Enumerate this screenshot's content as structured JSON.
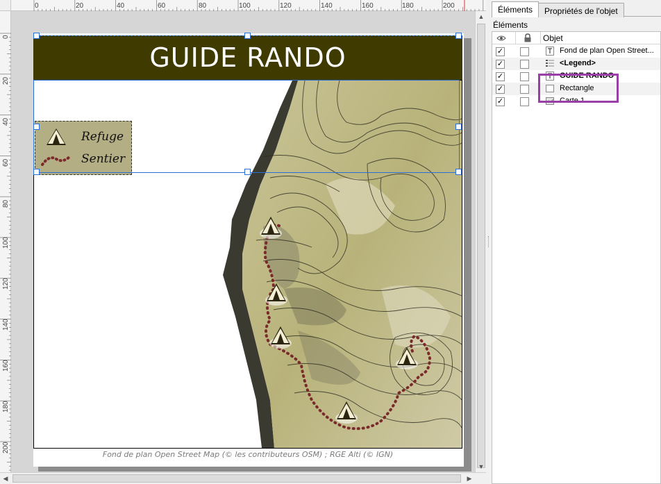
{
  "rulers": {
    "top_labels": [
      "0",
      "20",
      "40",
      "60",
      "80",
      "100",
      "120",
      "140",
      "160",
      "180",
      "200"
    ],
    "left_labels": [
      "0",
      "20",
      "40",
      "60",
      "80",
      "100",
      "120",
      "140",
      "160",
      "180",
      "200"
    ]
  },
  "layout_page": {
    "title": "GUIDE RANDO",
    "attribution": "Fond de plan Open Street Map (© les contributeurs OSM) ; RGE Alti (© IGN)",
    "title_background": "#3e3a00",
    "legend": {
      "background": "#b3ae84",
      "items": [
        {
          "label": "Refuge",
          "icon": "tent-icon"
        },
        {
          "label": "Sentier",
          "icon": "dotted-trail-icon"
        }
      ]
    },
    "trail_color": "#7a2a2a"
  },
  "panel": {
    "tabs": [
      "Éléments",
      "Propriétés de l'objet"
    ],
    "active_tab": "Éléments",
    "heading": "Éléments",
    "columns": {
      "visible": "eye-icon",
      "locked": "lock-icon",
      "object": "Objet"
    },
    "items": [
      {
        "label": "Fond de plan Open Street...",
        "icon": "text-icon",
        "visible": "✓",
        "bold": false
      },
      {
        "label": "<Legend>",
        "icon": "legend-icon",
        "visible": "✓",
        "bold": true
      },
      {
        "label": "GUIDE RANDO",
        "icon": "text-icon",
        "visible": "✓",
        "bold": true
      },
      {
        "label": "Rectangle",
        "icon": "rectangle-icon",
        "visible": "✓",
        "bold": false
      },
      {
        "label": "Carte 1",
        "icon": "map-icon",
        "visible": "✓",
        "bold": false
      }
    ],
    "highlight_color": "#9b3fa8"
  }
}
